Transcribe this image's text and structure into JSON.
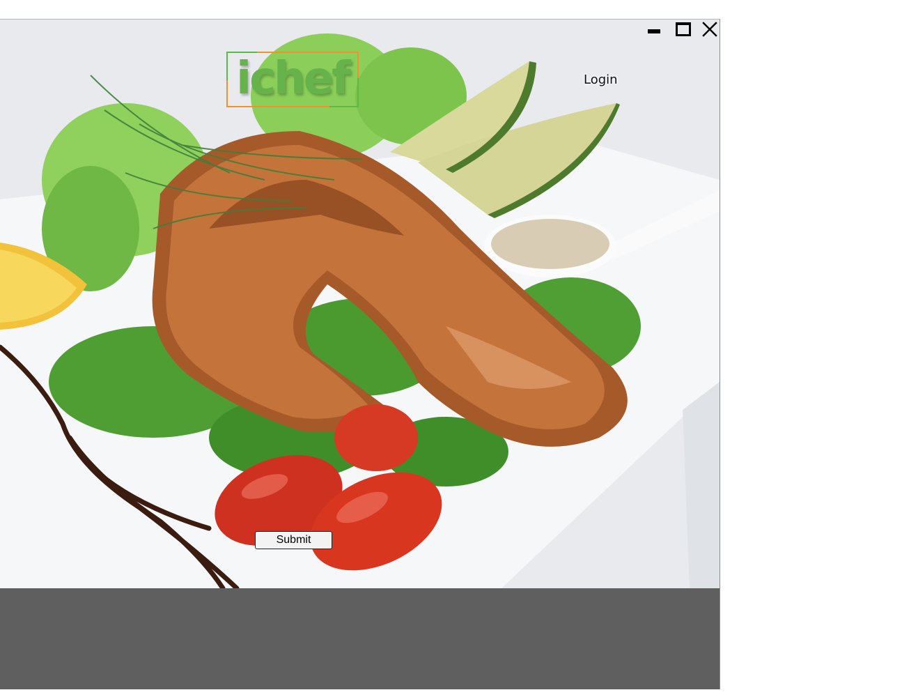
{
  "window": {
    "controls": {
      "minimize_icon": "minimize-icon",
      "maximize_icon": "maximize-icon",
      "close_icon": "close-icon"
    }
  },
  "header": {
    "logo_text": "ichef",
    "login_label": "Login"
  },
  "form": {
    "submit_label": "Submit"
  },
  "colors": {
    "logo_green": "#67b34b",
    "logo_frame_orange": "#f0922a",
    "bottom_panel": "#5f5f5f"
  },
  "hero_image": {
    "icon": "food-photo"
  }
}
